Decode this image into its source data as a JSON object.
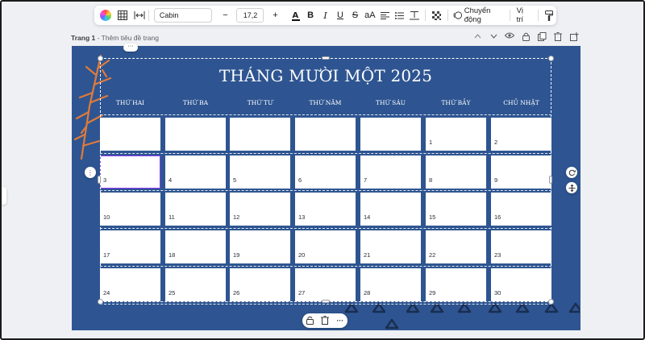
{
  "toolbar": {
    "font_name": "Cabin",
    "font_size": "17,2",
    "size_minus": "−",
    "size_plus": "+",
    "case_label": "aA",
    "motion_label": "Chuyển động",
    "position_label": "Vị trí",
    "icons": [
      "color-wheel-icon",
      "grid-icon",
      "spacing-icon",
      "text-color-icon",
      "bold-icon",
      "italic-icon",
      "underline-icon",
      "strikethrough-icon",
      "case-icon",
      "align-icon",
      "list-icon",
      "text-spacing-icon",
      "transparency-icon",
      "motion-icon",
      "paint-format-icon"
    ]
  },
  "page": {
    "label": "Trang 1",
    "separator": " - ",
    "title_placeholder": "Thêm tiêu đề trang"
  },
  "calendar": {
    "title": "THÁNG MƯỜI MỘT 2025",
    "days": [
      "THỨ HAI",
      "THỨ BA",
      "THỨ TƯ",
      "THỨ NĂM",
      "THỨ SÁU",
      "THỨ BẢY",
      "CHỦ NHẬT"
    ],
    "weeks": [
      [
        "",
        "",
        "",
        "",
        "",
        "1",
        "2"
      ],
      [
        "3",
        "4",
        "5",
        "6",
        "7",
        "8",
        "9"
      ],
      [
        "10",
        "11",
        "12",
        "13",
        "14",
        "15",
        "16"
      ],
      [
        "17",
        "18",
        "19",
        "20",
        "21",
        "22",
        "23"
      ],
      [
        "24",
        "25",
        "26",
        "27",
        "28",
        "29",
        "30"
      ]
    ],
    "selected_day": "3",
    "background_color": "#2e5591",
    "accent_color": "#e07a3a"
  },
  "float_controls": {
    "top_more": "···",
    "side_more": "⋮",
    "bottom_more": "···"
  }
}
